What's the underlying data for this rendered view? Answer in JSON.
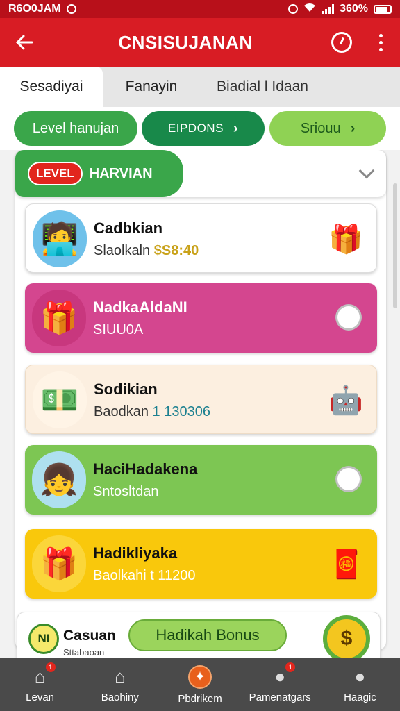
{
  "status_bar": {
    "left_text": "R6O0JAM",
    "right_text": "360%"
  },
  "app_bar": {
    "title": "CNSISUJANAN",
    "back_icon": "back-arrow-icon",
    "timer_icon": "timer-icon",
    "menu_icon": "more-vert-icon"
  },
  "tabs": [
    {
      "label": "Sesadiyai",
      "active": true
    },
    {
      "label": "Fanayin",
      "active": false
    },
    {
      "label": "Biadial l Idaan",
      "active": false
    }
  ],
  "chips": [
    {
      "label": "Level hanujan"
    },
    {
      "label": "EIPDONS"
    },
    {
      "label": "Sriouu"
    }
  ],
  "level_section": {
    "badge": "LEVEL",
    "title": "HARVIAN"
  },
  "cards": [
    {
      "title": "Cadbkian",
      "subtitle": "Slaolkaln",
      "amount": "$S8:40",
      "icon": "person-typing-icon",
      "side_icon": "gift-box-icon"
    },
    {
      "title": "NadkaAldaNI",
      "subtitle": "SIUU0A",
      "icon": "gift-coins-icon",
      "side_icon": "chat-bubble-icon"
    },
    {
      "title": "Sodikian",
      "subtitle": "Baodkan",
      "amount": "1 130306",
      "icon": "cash-bundle-icon",
      "side_icon": "robot-icon"
    },
    {
      "title": "HaciHadakena",
      "subtitle": "Sntosltdan",
      "icon": "person-laptop-icon",
      "side_icon": "chat-bubble-icon"
    },
    {
      "title": "Hadikliyaka",
      "subtitle": "Baolkahi t 11200",
      "icon": "gift-coins-icon",
      "side_icon": "mascot-icon"
    }
  ],
  "bonus": {
    "badge": "NI",
    "title": "Casuan",
    "subtitle": "Sttabaoan",
    "button_label": "Hadikah Bonus",
    "coin_symbol": "$"
  },
  "bottom_nav": [
    {
      "label": "Levan",
      "icon": "home-badge-icon",
      "badge": "1"
    },
    {
      "label": "Baohiny",
      "icon": "house-icon"
    },
    {
      "label": "Pbdrikem",
      "icon": "bonus-center-icon"
    },
    {
      "label": "Pamenatgars",
      "icon": "user-chat-icon",
      "badge": "1"
    },
    {
      "label": "Haagic",
      "icon": "profile-icon"
    }
  ],
  "colors": {
    "primary_red": "#d81c24",
    "green": "#3aa64a",
    "pink": "#d4468f",
    "lime": "#7dc653",
    "yellow": "#f9c80c"
  }
}
